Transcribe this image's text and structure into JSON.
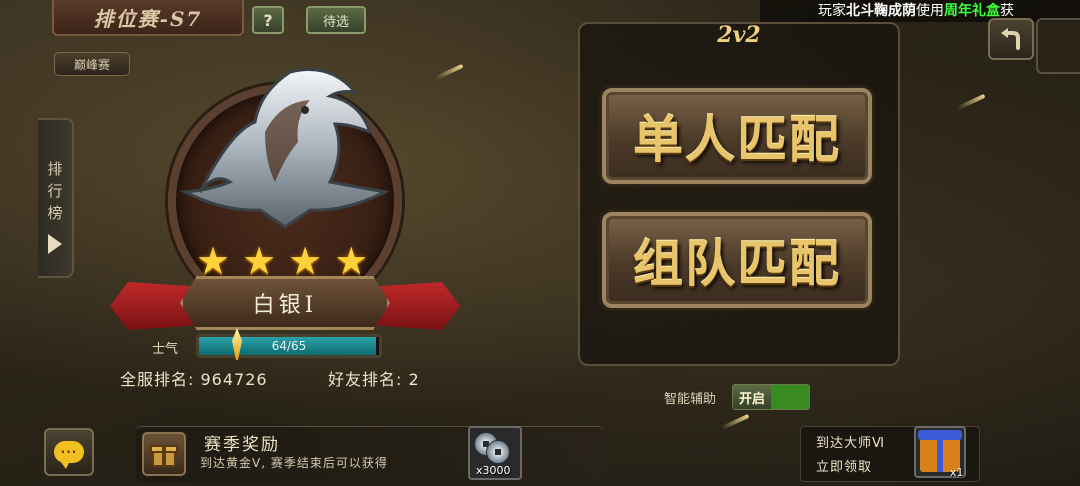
{
  "header": {
    "title": "排位赛-S7",
    "help_label": "?",
    "filter_label": "待选",
    "back_icon": "back-arrow-icon"
  },
  "ticker": {
    "prefix": "玩家",
    "player": "北斗鞠成荫",
    "verb": "使用",
    "item": "周年礼盒",
    "suffix": "获"
  },
  "peak_label": "巅峰赛",
  "leaderboard_tab": [
    "排",
    "行",
    "榜"
  ],
  "rank": {
    "stars": 4,
    "tier_name": "白银Ⅰ",
    "morale_label": "士气",
    "morale_current": 64,
    "morale_max": 65,
    "morale_text": "64/65",
    "server_rank": "全服排名: 964726",
    "friend_rank": "好友排名: 2"
  },
  "mode": {
    "title": "2v2",
    "solo_label": "单人匹配",
    "team_label": "组队匹配"
  },
  "assist": {
    "label": "智能辅助",
    "toggle_label": "开启"
  },
  "season": {
    "title": "赛季奖励",
    "desc": "到达黄金Ⅴ, 赛季结束后可以获得",
    "reward_qty": "x3000"
  },
  "master": {
    "title": "到达大师Ⅵ",
    "claim": "立即领取",
    "reward_qty": "x1"
  },
  "chat_icon": "chat-icon",
  "colors": {
    "gold_text": "#e8c46a",
    "morale_fill": "#2aa3a6",
    "ribbon_red": "#c0282a",
    "ticker_green": "#3cff3c"
  }
}
